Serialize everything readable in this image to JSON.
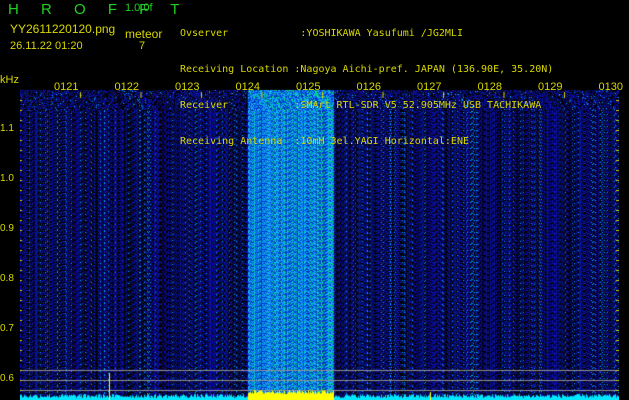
{
  "header": {
    "app_title": "H R O F F T",
    "version": "1.0.0f",
    "filename": "YY2611220120.png",
    "datetime": "26.11.22 01:20",
    "event_type": "meteor",
    "event_count": "7"
  },
  "info": {
    "observer": "Ovserver            :YOSHIKAWA Yasufumi /JG2MLI",
    "location": "Receiving Location :Nagoya Aichi-pref. JAPAN (136.90E, 35.20N)",
    "receiver": "Receiver           :SMArt RTL-SDR V5 52.905MHz USB TACHIKAWA",
    "antenna": "Receiving Antenna  :10mH 3el.YAGI Horizontal:ENE"
  },
  "spectrogram": {
    "y_unit": "kHz",
    "y_ticks": [
      "1.1",
      "1.0",
      "0.9",
      "0.8",
      "0.7",
      "0.6"
    ],
    "x_ticks": [
      "0121",
      "0122",
      "0123",
      "0124",
      "0125",
      "0126",
      "0127",
      "0128",
      "0129",
      "0130"
    ],
    "colors": {
      "background": "#000000",
      "noise": "#1a2aa0",
      "signal": "#30b0ff",
      "baseline": "#00e8ff",
      "peak": "#ffff00",
      "text": "#d8d800"
    }
  }
}
